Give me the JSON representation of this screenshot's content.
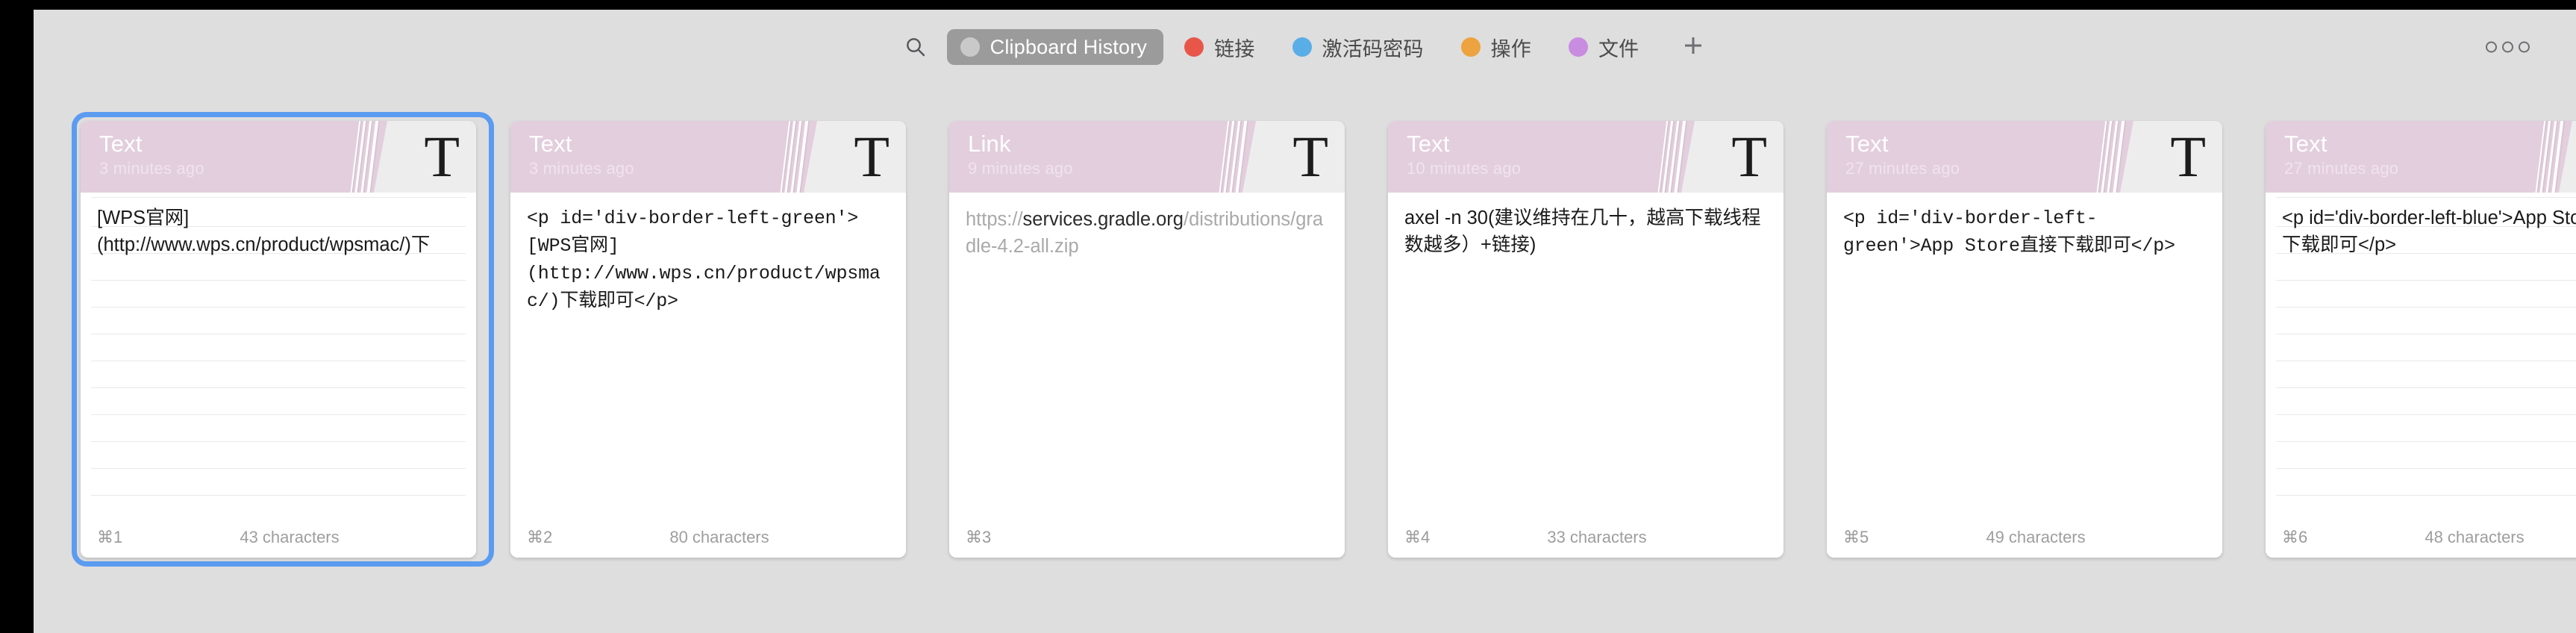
{
  "window": {
    "background_color": "#dedede",
    "desktop_color": "#000000"
  },
  "toolbar": {
    "search_icon": "search-icon",
    "add_icon": "plus-icon",
    "overflow_icon": "more-horizontal-icon",
    "filters": [
      {
        "label": "Clipboard History",
        "dot_color": "#c9c9c9",
        "active": true,
        "pill_color": "#9b9b9b"
      },
      {
        "label": "链接",
        "dot_color": "#e8564a",
        "active": false,
        "pill_color": ""
      },
      {
        "label": "激活码密码",
        "dot_color": "#5aaee8",
        "active": false,
        "pill_color": ""
      },
      {
        "label": "操作",
        "dot_color": "#eda33f",
        "active": false,
        "pill_color": ""
      },
      {
        "label": "文件",
        "dot_color": "#c88ce0",
        "active": false,
        "pill_color": ""
      }
    ]
  },
  "cards": [
    {
      "type_label": "Text",
      "time": "3 minutes ago",
      "icon": "T",
      "body": "[WPS官网](http://www.wps.cn/product/wpsmac/)下",
      "mono": false,
      "ruled": true,
      "shortcut": "⌘1",
      "char_count": "43 characters",
      "selected": true,
      "header_color": "#e3cedd"
    },
    {
      "type_label": "Text",
      "time": "3 minutes ago",
      "icon": "T",
      "body": "<p id='div-border-left-green'>[WPS官网](http://www.wps.cn/product/wpsmac/)下载即可</p>",
      "mono": true,
      "ruled": false,
      "shortcut": "⌘2",
      "char_count": "80 characters",
      "selected": false,
      "header_color": "#e3cedd"
    },
    {
      "type_label": "Link",
      "time": "9 minutes ago",
      "icon": "T",
      "body": "https://services.gradle.org/distributions/gradle-4.2-all.zip",
      "link_prefix": "https://",
      "link_host": "services.gradle.org",
      "link_path": "/distributions/gradle-4.2-all.zip",
      "mono": false,
      "ruled": false,
      "shortcut": "⌘3",
      "char_count": "",
      "selected": false,
      "header_color": "#e3cedd"
    },
    {
      "type_label": "Text",
      "time": "10 minutes ago",
      "icon": "T",
      "body": "axel -n 30(建议维持在几十，越高下载线程数越多）+链接)",
      "mono": false,
      "ruled": false,
      "shortcut": "⌘4",
      "char_count": "33 characters",
      "selected": false,
      "header_color": "#e3cedd"
    },
    {
      "type_label": "Text",
      "time": "27 minutes ago",
      "icon": "T",
      "body": "<p id='div-border-left-green'>App Store直接下载即可</p>",
      "mono": true,
      "ruled": false,
      "shortcut": "⌘5",
      "char_count": "49 characters",
      "selected": false,
      "header_color": "#e3cedd"
    },
    {
      "type_label": "Text",
      "time": "27 minutes ago",
      "icon": "T",
      "body": "<p id='div-border-left-blue'>App Store直接下载即可</p>",
      "mono": false,
      "ruled": true,
      "shortcut": "⌘6",
      "char_count": "48 characters",
      "selected": false,
      "header_color": "#e3cedd"
    }
  ]
}
